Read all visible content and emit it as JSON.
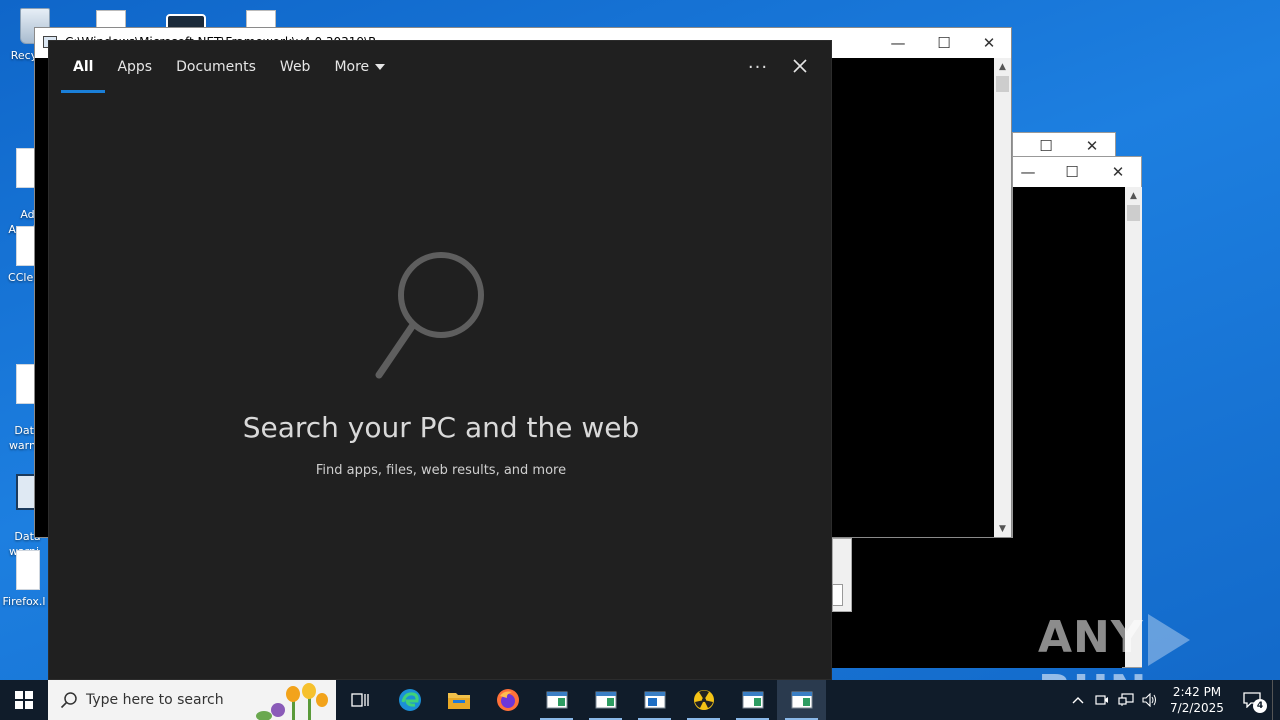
{
  "desktop": {
    "icons": [
      {
        "label": "Recy",
        "icon": "recycle-bin-icon"
      },
      {
        "label": "Ad\nAcrob",
        "icon": "acrobat-icon"
      },
      {
        "label": "CClea",
        "icon": "ccleaner-icon"
      },
      {
        "label": "Data\nwarni",
        "icon": "document-icon"
      },
      {
        "label": "Data\nwarni",
        "icon": "document-icon"
      },
      {
        "label": "Firefox.l",
        "icon": "document-icon"
      }
    ]
  },
  "background_windows": {
    "main_title": "C:\\Windows\\Microsoft.NET\\Framework\\v4.0.30319\\R...",
    "minimize_glyph": "—",
    "maximize_glyph": "☐",
    "close_glyph": "✕"
  },
  "search_flyout": {
    "tabs": [
      {
        "label": "All",
        "active": true
      },
      {
        "label": "Apps",
        "active": false
      },
      {
        "label": "Documents",
        "active": false
      },
      {
        "label": "Web",
        "active": false
      },
      {
        "label": "More",
        "active": false,
        "dropdown": true
      }
    ],
    "more_options_glyph": "···",
    "hero_title": "Search your PC and the web",
    "hero_subtitle": "Find apps, files, web results, and more",
    "accent_color": "#1a7fd8",
    "background_color": "#202020"
  },
  "watermark": {
    "left_text": "ANY",
    "right_text": "RUN"
  },
  "taskbar": {
    "search_placeholder": "Type here to search",
    "apps": [
      {
        "icon": "task-view-icon",
        "running": false
      },
      {
        "icon": "edge-icon",
        "running": false
      },
      {
        "icon": "file-explorer-icon",
        "running": false
      },
      {
        "icon": "firefox-icon",
        "running": false
      },
      {
        "icon": "console-window-icon",
        "running": true
      },
      {
        "icon": "console-window-icon",
        "running": true
      },
      {
        "icon": "app-window-icon",
        "running": true
      },
      {
        "icon": "radiation-icon",
        "running": true
      },
      {
        "icon": "console-window-icon",
        "running": true
      },
      {
        "icon": "console-window-icon",
        "running": true,
        "current": true
      }
    ],
    "tray": {
      "chevron_glyph": "^",
      "time": "2:42 PM",
      "date": "7/2/2025",
      "notification_count": "4"
    }
  }
}
